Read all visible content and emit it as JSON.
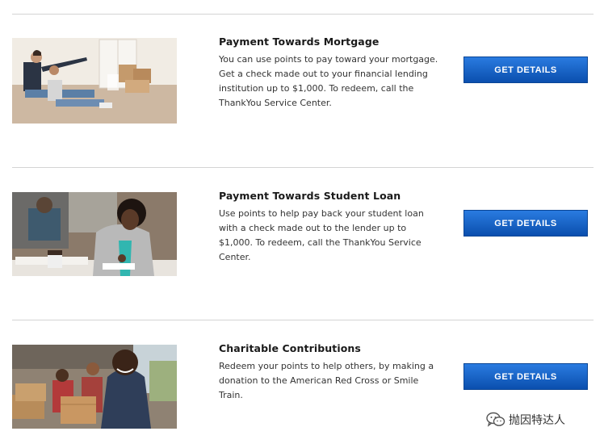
{
  "offers": [
    {
      "title": "Payment Towards Mortgage",
      "description": "You can use points to pay toward your mortgage. Get a check made out to your financial lending institution up to $1,000. To redeem, call the ThankYou Service Center.",
      "button_label": "GET DETAILS",
      "image_icon": "couple-new-home-photo"
    },
    {
      "title": "Payment Towards Student Loan",
      "description": "Use points to help pay back your student loan with a check made out to the lender up to $1,000. To redeem, call the ThankYou Service Center.",
      "button_label": "GET DETAILS",
      "image_icon": "student-studying-photo"
    },
    {
      "title": "Charitable Contributions",
      "description": "Redeem your points to help others, by making a donation to the American Red Cross or Smile Train.",
      "button_label": "GET DETAILS",
      "image_icon": "volunteers-boxes-photo"
    }
  ],
  "watermark": {
    "text": "抛因特达人",
    "icon": "wechat-icon"
  },
  "colors": {
    "button_top": "#2a7be0",
    "button_bottom": "#0b4fae",
    "divider": "#d4d4d4"
  }
}
